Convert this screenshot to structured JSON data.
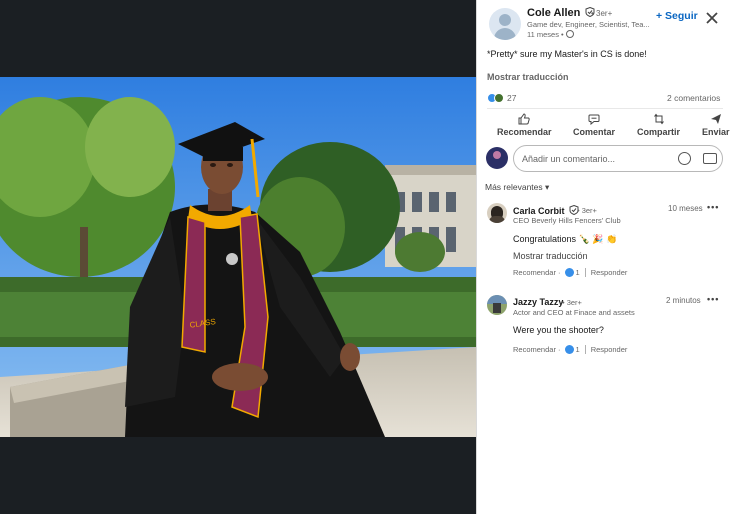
{
  "post": {
    "author_name": "Cole Allen",
    "degree": "• 3er+",
    "headline": "Game dev, Engineer, Scientist, Tea...",
    "time": "11 meses •",
    "follow_label": "+ Seguir",
    "text": "*Pretty* sure my Master's in CS is done!",
    "translate_label": "Mostrar traducción",
    "reaction_count": "27",
    "comments_count": "2 comentarios"
  },
  "actions": [
    {
      "label": "Recomendar",
      "icon": "thumbs-up-icon"
    },
    {
      "label": "Comentar",
      "icon": "comment-icon"
    },
    {
      "label": "Compartir",
      "icon": "repost-icon"
    },
    {
      "label": "Enviar",
      "icon": "send-icon"
    }
  ],
  "comment_box": {
    "placeholder": "Añadir un comentario..."
  },
  "sort_label": "Más relevantes",
  "comments": [
    {
      "name": "Carla Corbit",
      "degree": "• 3er+",
      "headline": "CEO Beverly Hills Fencers' Club",
      "time": "10 meses",
      "text": "Congratulations 🍾 🎉 👏",
      "translate_label": "Mostrar traducción",
      "like_label": "Recomendar ·",
      "like_count": "1",
      "reply_label": "Responder"
    },
    {
      "name": "Jazzy Tazzy",
      "degree": "• 3er+",
      "headline": "Actor and CEO at Finace and assets",
      "time": "2 minutos",
      "text": "Were you the shooter?",
      "like_label": "Recomendar ·",
      "like_count": "1",
      "reply_label": "Responder"
    }
  ],
  "more_label": "•••",
  "photo": {
    "cap_text": "CLASS OF 2023"
  },
  "colors": {
    "brand_blue": "#0a66c2",
    "gown": "#141414",
    "stole": "#8b2a55",
    "hood_gold": "#f2a900",
    "sky": "#3f8fe6"
  }
}
